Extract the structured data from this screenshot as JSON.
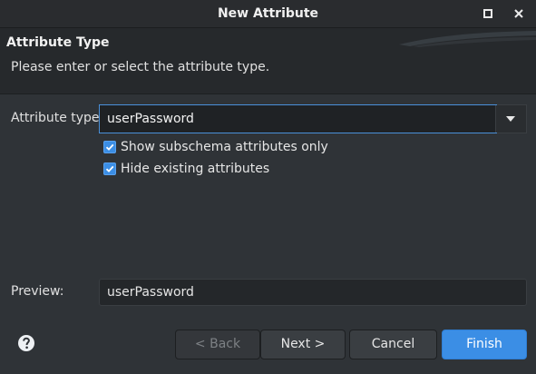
{
  "window": {
    "title": "New Attribute"
  },
  "header": {
    "title": "Attribute Type",
    "description": "Please enter or select the attribute type."
  },
  "form": {
    "attribute_type_label": "Attribute type:",
    "attribute_type_value": "userPassword",
    "show_subschema_label": "Show subschema attributes only",
    "show_subschema_checked": true,
    "hide_existing_label": "Hide existing attributes",
    "hide_existing_checked": true,
    "preview_label": "Preview:",
    "preview_value": "userPassword"
  },
  "buttons": {
    "back": "< Back",
    "next": "Next >",
    "cancel": "Cancel",
    "finish": "Finish"
  },
  "icons": {
    "maximize": "maximize-icon",
    "close": "close-icon",
    "dropdown": "chevron-down-icon",
    "help": "help-icon"
  },
  "colors": {
    "accent": "#3b8ee5",
    "background": "#2f3337",
    "header_background": "#26292c"
  }
}
